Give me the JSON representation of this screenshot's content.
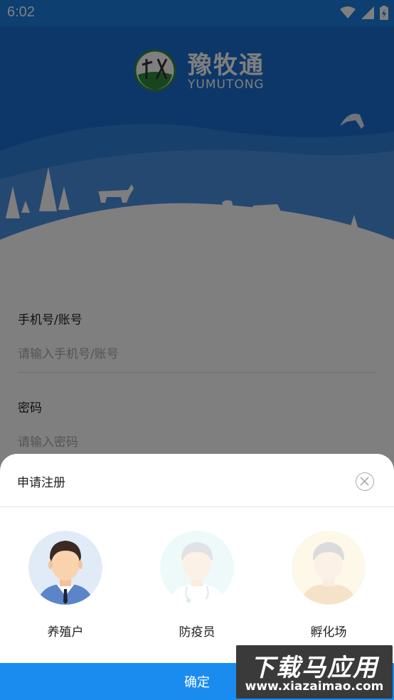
{
  "status_bar": {
    "time": "6:02"
  },
  "logo": {
    "cn": "豫牧通",
    "en": "YUMUTONG"
  },
  "form": {
    "phone_label": "手机号/账号",
    "phone_placeholder": "请输入手机号/账号",
    "password_label": "密码",
    "password_placeholder": "请输入密码"
  },
  "sheet": {
    "title": "申请注册",
    "roles": [
      {
        "label": "养殖户",
        "icon": "farmer-avatar",
        "selected": true
      },
      {
        "label": "防疫员",
        "icon": "doctor-avatar",
        "selected": false
      },
      {
        "label": "孵化场",
        "icon": "hatchery-avatar",
        "selected": false
      }
    ],
    "confirm_label": "确定"
  },
  "watermark": {
    "cn": "下载马应用",
    "en": "www.xiazaimao.com"
  },
  "colors": {
    "primary": "#1a8cf0",
    "statusbar": "#1a7fe0"
  }
}
